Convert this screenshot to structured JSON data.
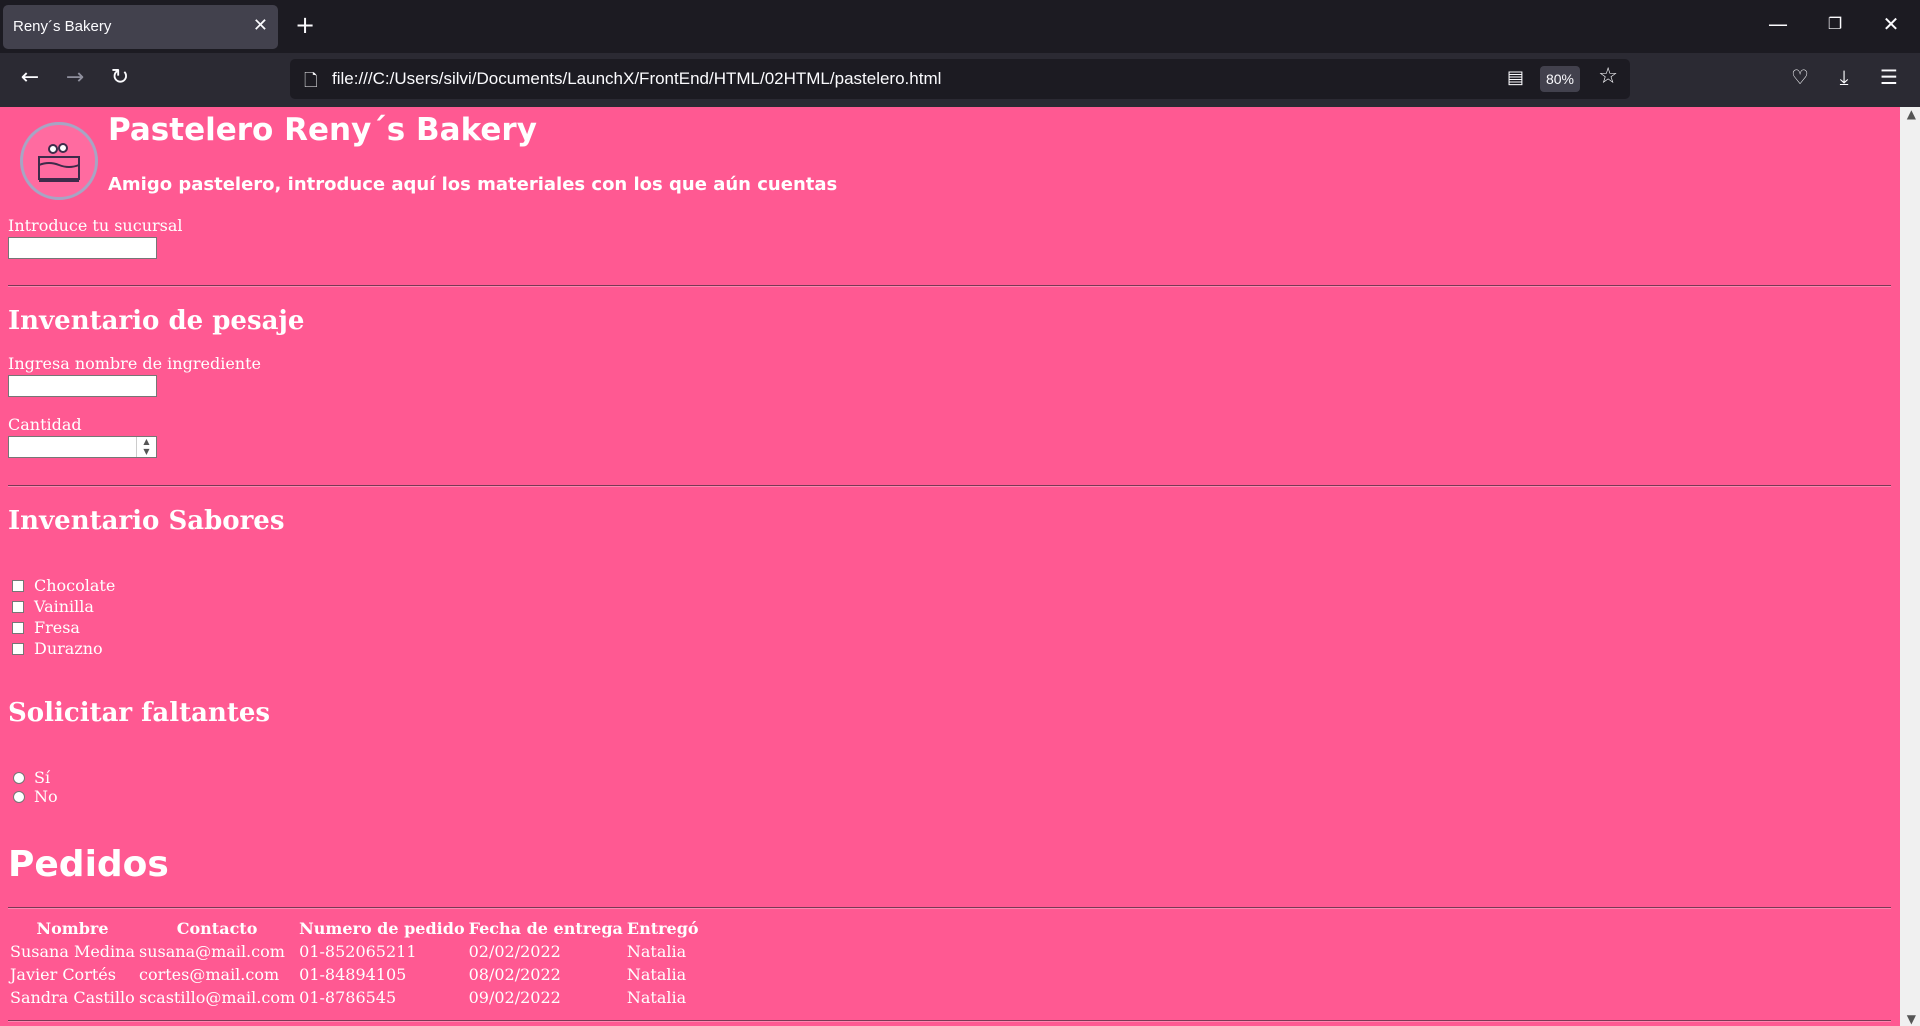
{
  "browser": {
    "tab_title": "Reny´s Bakery",
    "url": "file:///C:/Users/silvi/Documents/LaunchX/FrontEnd/HTML/02HTML/pastelero.html",
    "zoom": "80%"
  },
  "header": {
    "title": "Pastelero Reny´s Bakery",
    "subtitle": "Amigo pastelero, introduce aquí los materiales con los que aún cuentas"
  },
  "sucursal": {
    "label": "Introduce tu sucursal",
    "value": ""
  },
  "pesaje": {
    "heading": "Inventario de pesaje",
    "ingredient_label": "Ingresa nombre de ingrediente",
    "ingredient_value": "",
    "quantity_label": "Cantidad",
    "quantity_value": ""
  },
  "sabores": {
    "heading": "Inventario Sabores",
    "options": [
      "Chocolate",
      "Vainilla",
      "Fresa",
      "Durazno"
    ]
  },
  "faltantes": {
    "heading": "Solicitar faltantes",
    "options": [
      "Sí",
      "No"
    ]
  },
  "pedidos": {
    "heading": "Pedidos",
    "columns": [
      "Nombre",
      "Contacto",
      "Numero de pedido",
      "Fecha de entrega",
      "Entregó"
    ],
    "rows": [
      [
        "Susana Medina",
        "susana@mail.com",
        "01-852065211",
        "02/02/2022",
        "Natalia"
      ],
      [
        "Javier Cortés",
        "cortes@mail.com",
        "01-84894105",
        "08/02/2022",
        "Natalia"
      ],
      [
        "Sandra Castillo",
        "scastillo@mail.com",
        "01-8786545",
        "09/02/2022",
        "Natalia"
      ]
    ]
  },
  "colors": {
    "page_bg": "#ff5992",
    "chrome_bg": "#1c1b22",
    "toolbar_bg": "#2b2a33"
  }
}
